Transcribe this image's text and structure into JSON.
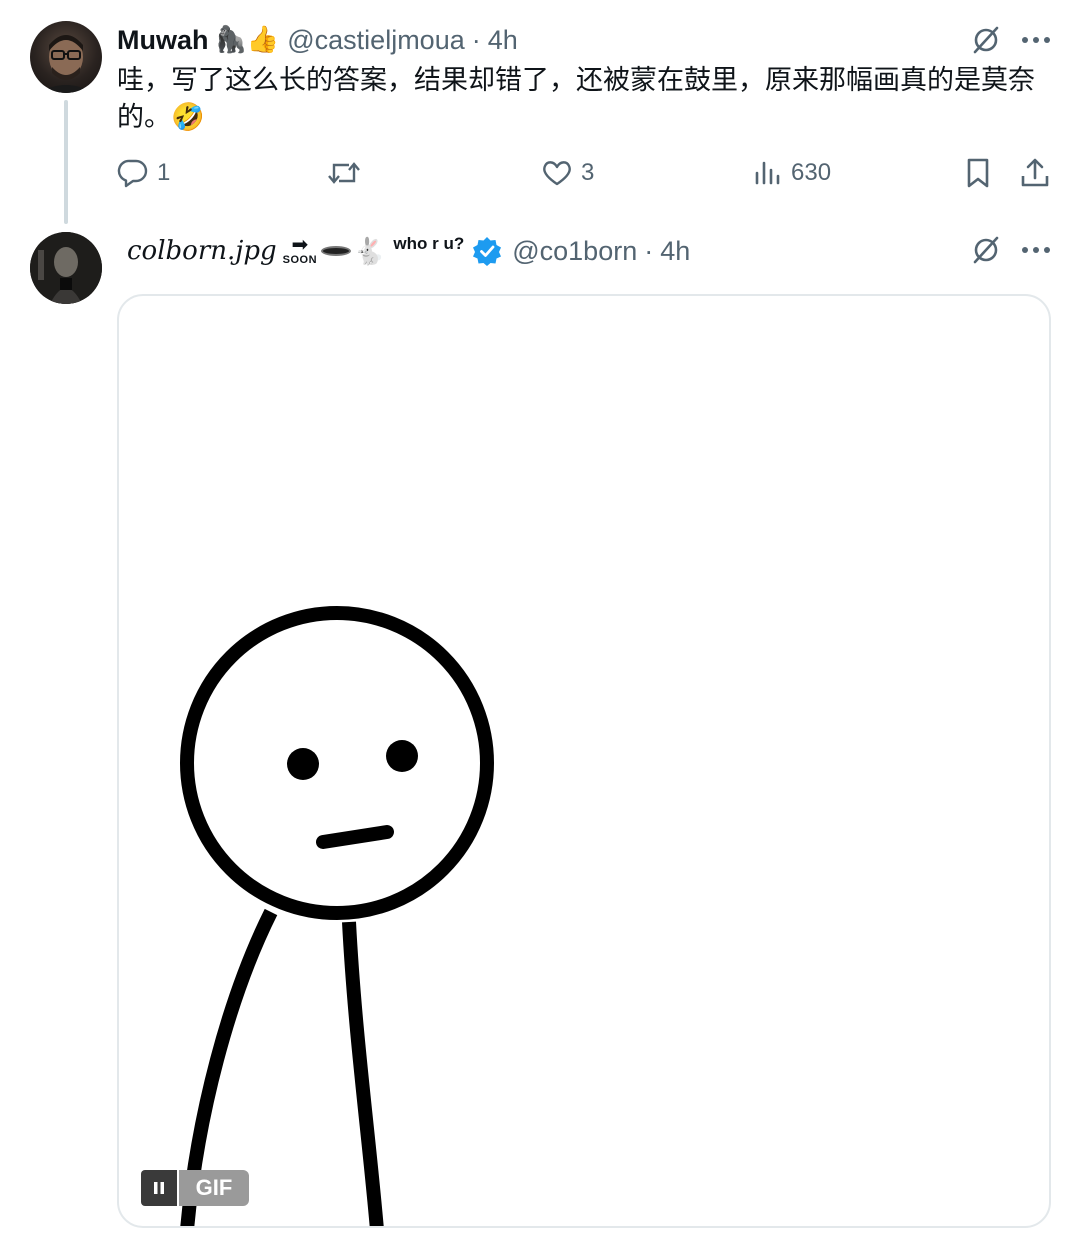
{
  "tweet1": {
    "name": "Muwah",
    "name_emojis": "🦍👍",
    "handle": "@castieljmoua",
    "separator": "·",
    "time": "4h",
    "text": "哇，写了这么长的答案，结果却错了，还被蒙在鼓里，原来那幅画真的是莫奈的。🤣",
    "stats": {
      "replies": "1",
      "likes": "3",
      "views": "630"
    }
  },
  "tweet2": {
    "name": "colborn.jpg",
    "soon_arrow": "➡",
    "soon_text": "SOON",
    "rabbit": "🐇",
    "who_text": "who r u?",
    "handle": "@co1born",
    "separator": "·",
    "time": "4h",
    "media": {
      "badge": "GIF",
      "pause_icon": "pause-icon"
    }
  },
  "colors": {
    "text": "#0f1419",
    "secondary": "#536471",
    "verified": "#1d9bf0",
    "thread_line": "#cfd9de",
    "media_border": "#e3e8eb"
  },
  "icons": [
    "grok-icon",
    "more-icon",
    "reply-icon",
    "retweet-icon",
    "like-icon",
    "views-icon",
    "bookmark-icon",
    "share-icon",
    "verified-badge-icon"
  ]
}
